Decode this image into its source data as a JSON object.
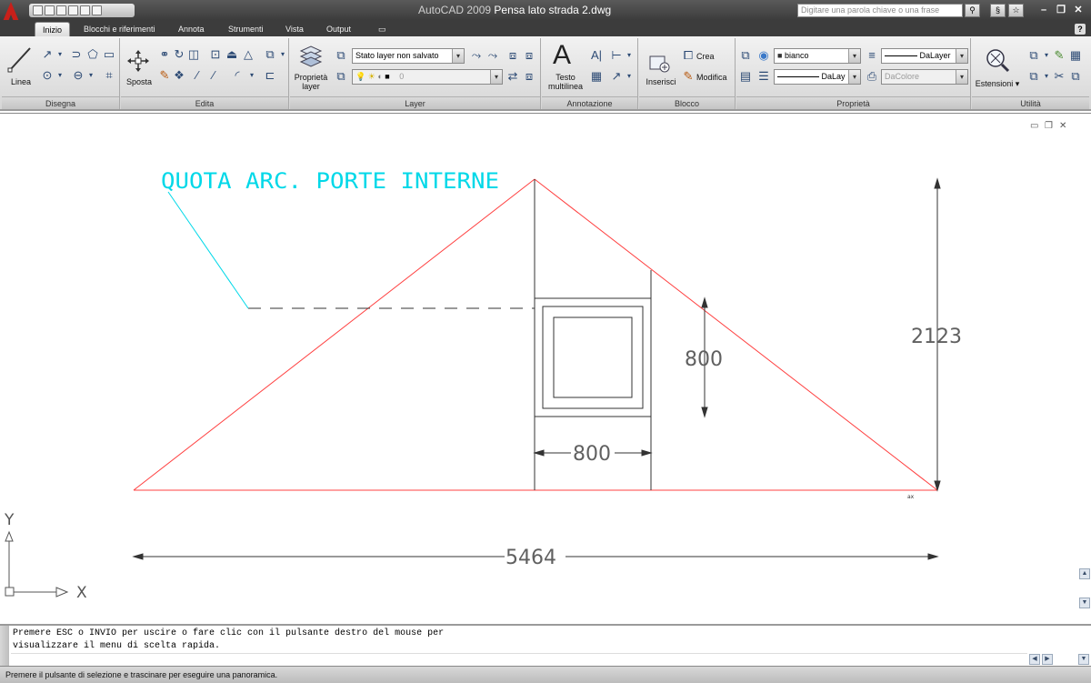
{
  "window": {
    "app_name": "AutoCAD 2009",
    "file_name": "Pensa lato strada 2.dwg",
    "search_placeholder": "Digitare una parola chiave o una frase"
  },
  "tabs": [
    {
      "label": "Inizio",
      "active": true
    },
    {
      "label": "Blocchi e riferimenti"
    },
    {
      "label": "Annota"
    },
    {
      "label": "Strumenti"
    },
    {
      "label": "Vista"
    },
    {
      "label": "Output"
    }
  ],
  "ribbon": {
    "panels": {
      "disegna": "Disegna",
      "edita": "Edita",
      "layer": "Layer",
      "annotazione": "Annotazione",
      "blocco": "Blocco",
      "proprieta": "Proprietà",
      "utilita": "Utilità"
    },
    "linea_label": "Linea",
    "sposta_label": "Sposta",
    "proprieta_layer_label_1": "Proprietà",
    "proprieta_layer_label_2": "layer",
    "layer_state": "Stato layer non salvato",
    "current_layer": "0",
    "testo_label_1": "Testo",
    "testo_label_2": "multilinea",
    "inserisci_label": "Inserisci",
    "crea_label": "Crea",
    "modifica_label": "Modifica",
    "color_value": "bianco",
    "linetype_value": "DaLayer",
    "lineweight_value": "DaLay",
    "plotstyle_value": "DaColore",
    "estensioni_label": "Estensioni"
  },
  "drawing": {
    "annotation_text": "QUOTA ARC. PORTE INTERNE",
    "dim_height_total": "2123",
    "dim_window_height": "800",
    "dim_window_width": "800",
    "dim_base_width": "5464",
    "ucs_x": "X",
    "ucs_y": "Y",
    "small_label": "ax",
    "colors": {
      "roof_line": "#ff4040",
      "annotation": "#00d8e8",
      "dimension": "#303030",
      "text_dim": "#606060"
    }
  },
  "command_line": {
    "line1": "Premere ESC o INVIO per uscire o fare clic con il pulsante destro del mouse per",
    "line2": "visualizzare il menu di scelta rapida."
  },
  "status_bar": {
    "text": "Premere il pulsante di selezione e trascinare per eseguire una panoramica."
  }
}
